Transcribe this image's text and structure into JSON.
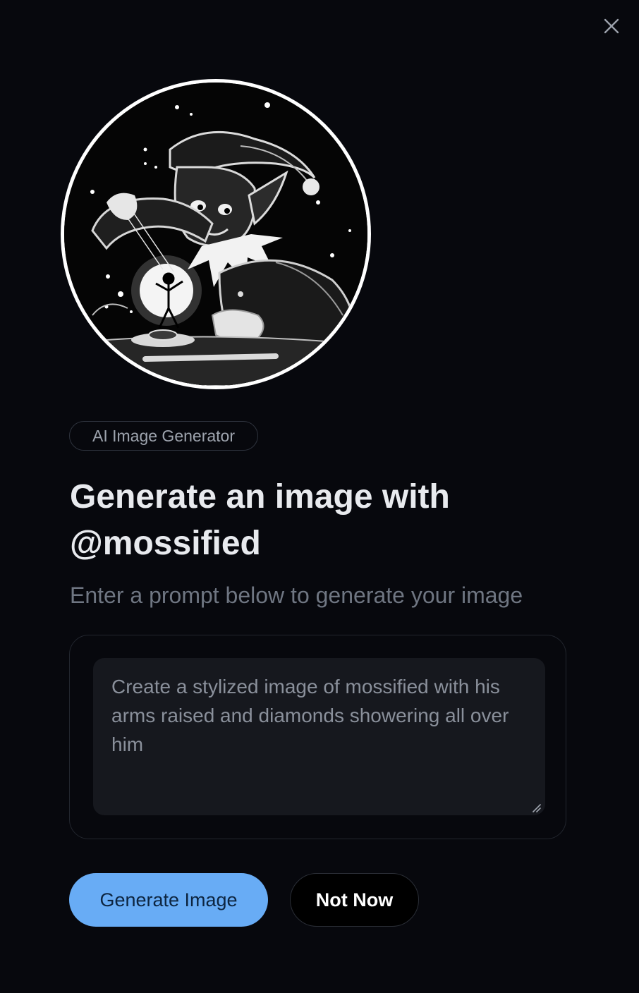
{
  "dialog": {
    "close_icon": "close-icon",
    "hero_image": "elf-puppeteer-illustration",
    "badge": "AI Image Generator",
    "title": "Generate an image with @mossified",
    "subtitle": "Enter a prompt below to generate your image",
    "prompt": {
      "placeholder": "Create a stylized image of mossified with his arms raised and diamonds showering all over him",
      "value": ""
    },
    "buttons": {
      "generate": "Generate Image",
      "not_now": "Not Now"
    }
  },
  "colors": {
    "background": "#07080d",
    "primary_button": "#68acf5",
    "title_text": "#e8eaee",
    "muted_text": "#6f7682"
  }
}
